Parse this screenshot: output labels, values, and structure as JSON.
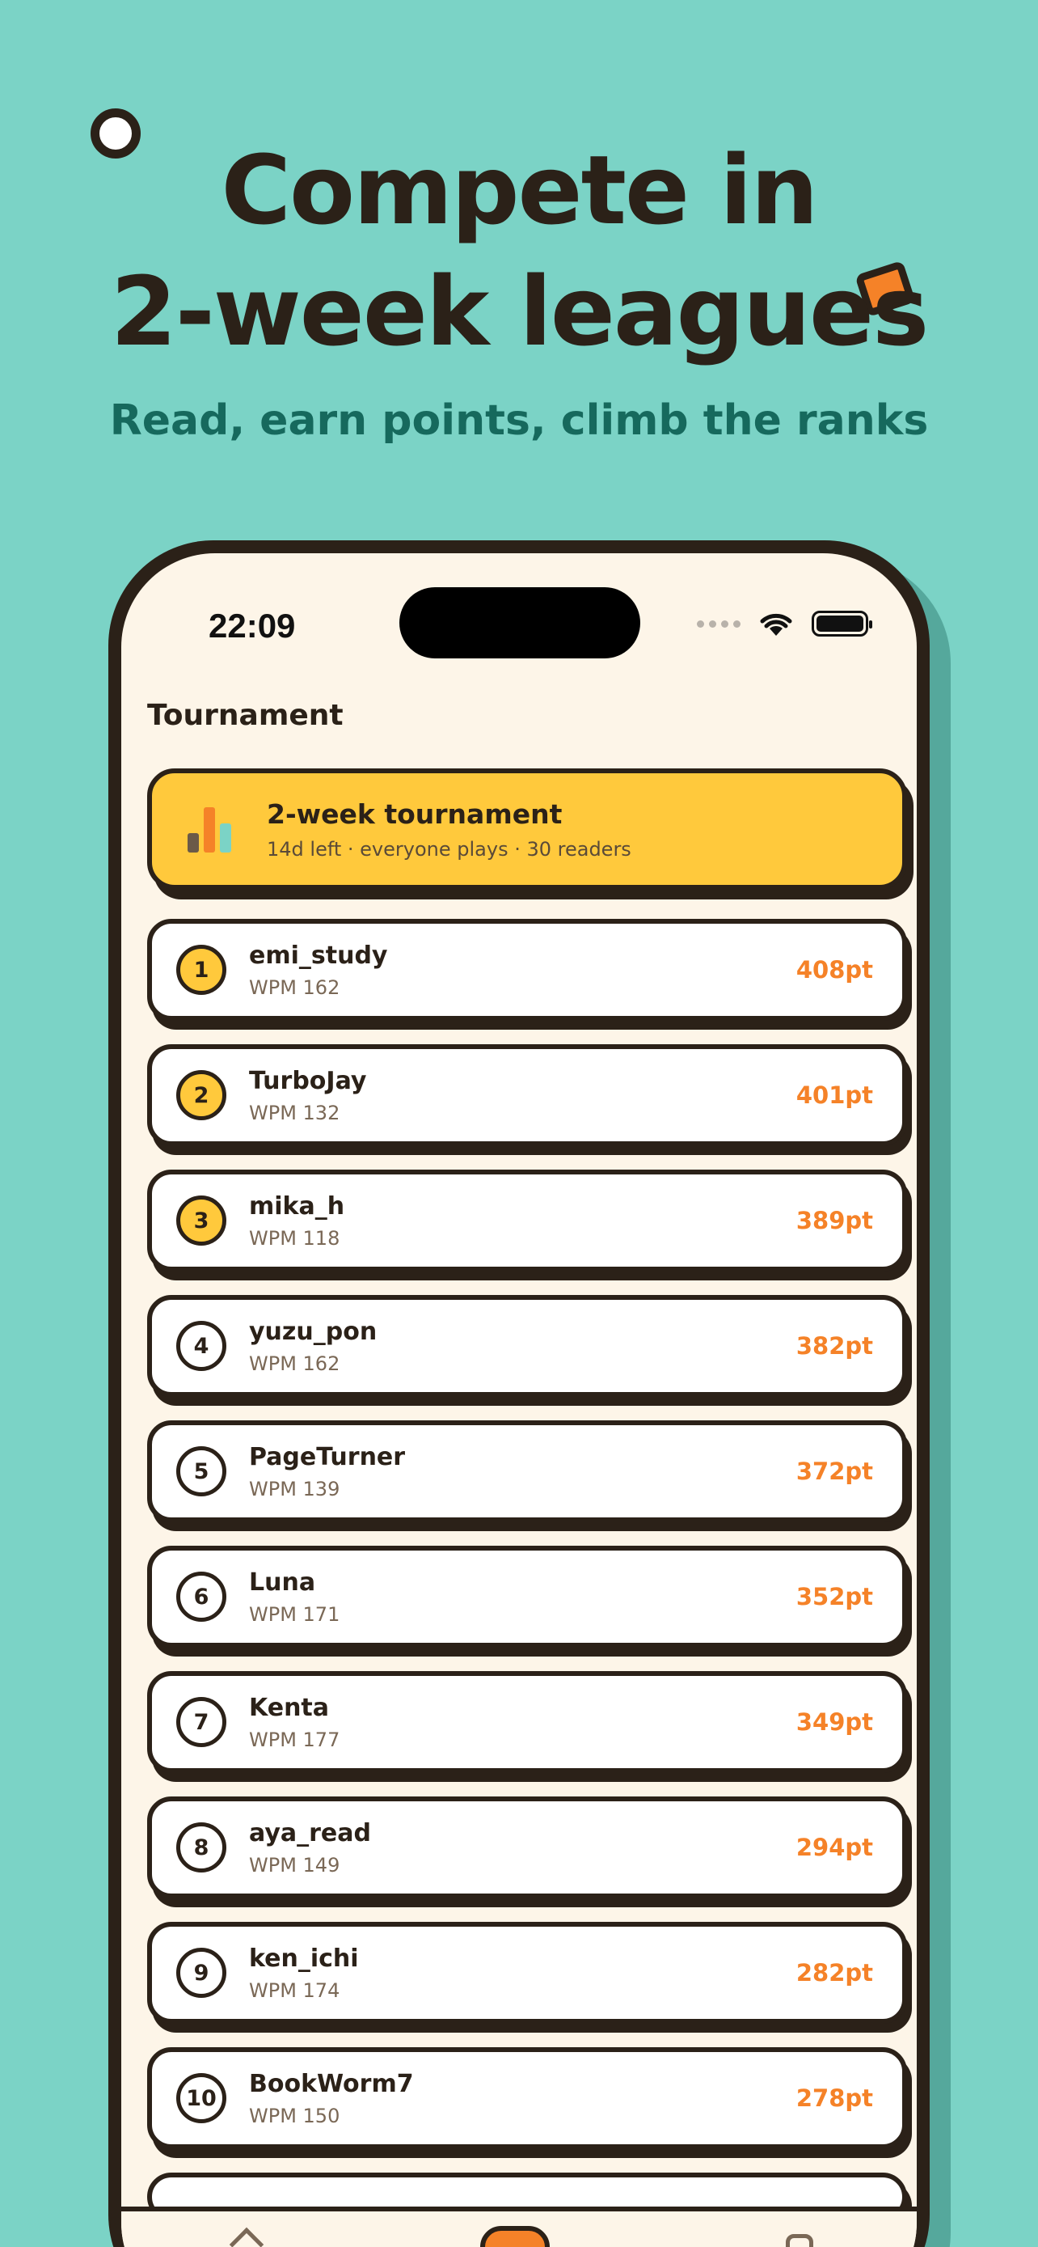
{
  "hero": {
    "title_line1": "Compete in",
    "title_line2": "2-week leagues",
    "subtitle": "Read, earn points, climb the ranks"
  },
  "status_bar": {
    "time": "22:09"
  },
  "screen": {
    "title": "Tournament"
  },
  "banner": {
    "title": "2-week tournament",
    "subtitle": "14d left · everyone plays · 30 readers"
  },
  "leaderboard": [
    {
      "rank": "1",
      "name": "emi_study",
      "wpm": "WPM 162",
      "points": "408pt"
    },
    {
      "rank": "2",
      "name": "TurboJay",
      "wpm": "WPM 132",
      "points": "401pt"
    },
    {
      "rank": "3",
      "name": "mika_h",
      "wpm": "WPM 118",
      "points": "389pt"
    },
    {
      "rank": "4",
      "name": "yuzu_pon",
      "wpm": "WPM 162",
      "points": "382pt"
    },
    {
      "rank": "5",
      "name": "PageTurner",
      "wpm": "WPM 139",
      "points": "372pt"
    },
    {
      "rank": "6",
      "name": "Luna",
      "wpm": "WPM 171",
      "points": "352pt"
    },
    {
      "rank": "7",
      "name": "Kenta",
      "wpm": "WPM 177",
      "points": "349pt"
    },
    {
      "rank": "8",
      "name": "aya_read",
      "wpm": "WPM 149",
      "points": "294pt"
    },
    {
      "rank": "9",
      "name": "ken_ichi",
      "wpm": "WPM 174",
      "points": "282pt"
    },
    {
      "rank": "10",
      "name": "BookWorm7",
      "wpm": "WPM 150",
      "points": "278pt"
    }
  ],
  "colors": {
    "background": "#7bd3c6",
    "ink": "#2b2118",
    "accent_yellow": "#ffc93c",
    "accent_orange": "#f58228",
    "screen_bg": "#fdf5e8",
    "subtitle_green": "#16695d"
  },
  "icons": {
    "banner": "bar-chart-icon",
    "tab_left": "home-icon",
    "tab_center": "tournament-icon",
    "tab_right": "profile-icon"
  }
}
